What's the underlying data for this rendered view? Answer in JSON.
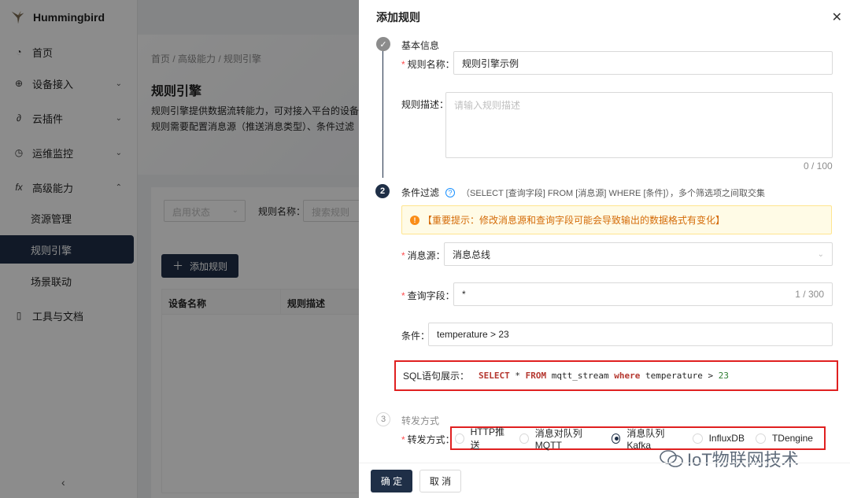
{
  "app": {
    "name": "Hummingbird"
  },
  "sidebar": {
    "items": [
      {
        "label": "首页",
        "icon": "dashboard-icon"
      },
      {
        "label": "设备接入",
        "icon": "globe-icon",
        "expand": "down"
      },
      {
        "label": "云插件",
        "icon": "plugin-icon",
        "expand": "down"
      },
      {
        "label": "运维监控",
        "icon": "monitor-icon",
        "expand": "down"
      },
      {
        "label": "高级能力",
        "icon": "function-icon",
        "expand": "up"
      }
    ],
    "subitems": [
      "资源管理",
      "规则引擎",
      "场景联动"
    ],
    "active_subitem": "规则引擎",
    "tools": {
      "label": "工具与文档",
      "icon": "document-icon"
    }
  },
  "main": {
    "breadcrumb": "首页 / 高级能力 / 规则引擎",
    "title": "规则引擎",
    "desc_line1": "规则引擎提供数据流转能力，可对接入平台的设备",
    "desc_line2": "规则需要配置消息源（推送消息类型）、条件过滤",
    "filter": {
      "status_placeholder": "启用状态",
      "name_label": "规则名称：",
      "name_placeholder": "搜索规则"
    },
    "add_button": "添加规则",
    "table_headers": [
      "设备名称",
      "规则描述"
    ]
  },
  "drawer": {
    "title": "添加规则",
    "step1": {
      "title": "基本信息",
      "name_label": "规则名称：",
      "name_value": "规则引擎示例",
      "desc_label": "规则描述：",
      "desc_placeholder": "请输入规则描述",
      "desc_counter": "0 / 100"
    },
    "step2": {
      "number": "2",
      "title": "条件过滤",
      "hint": "（SELECT [查询字段] FROM [消息源] WHERE [条件]），多个筛选项之间取交集",
      "alert": "【重要提示：修改消息源和查询字段可能会导致输出的数据格式有变化】",
      "source_label": "消息源：",
      "source_value": "消息总线",
      "fields_label": "查询字段：",
      "fields_value": "*",
      "fields_counter": "1 / 300",
      "cond_label": "条件：",
      "cond_value": "temperature > 23",
      "sql_label": "SQL语句展示：",
      "sql": {
        "kw_select": "SELECT",
        "star": " * ",
        "kw_from": "FROM",
        "table": " mqtt_stream ",
        "kw_where": "where",
        "expr": " temperature > ",
        "num": "23"
      }
    },
    "step3": {
      "number": "3",
      "title": "转发方式",
      "label": "转发方式：",
      "options": [
        "HTTP推送",
        "消息对队列MQTT",
        "消息队列Kafka",
        "InfluxDB",
        "TDengine"
      ],
      "selected": "消息队列Kafka"
    },
    "confirm": "确 定",
    "cancel": "取 消"
  },
  "watermark": "IoT物联网技术",
  "colors": {
    "primary": "#1f2f47",
    "highlight": "#e02020",
    "required": "#ff4d4f",
    "alert_bg": "#fffbe6"
  }
}
